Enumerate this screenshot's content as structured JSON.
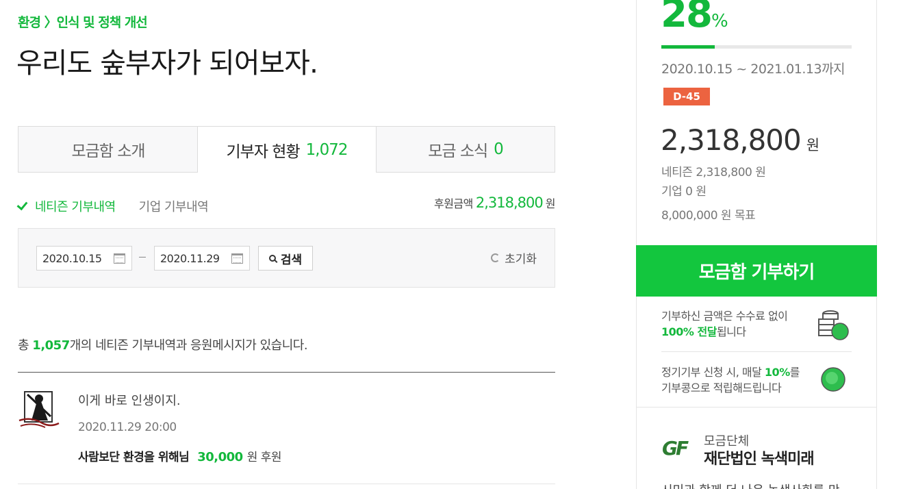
{
  "breadcrumb": "환경 〉인식 및 정책 개선",
  "title": "우리도 숲부자가 되어보자.",
  "tabs": [
    {
      "label": "모금함 소개",
      "count": ""
    },
    {
      "label": "기부자 현황",
      "count": "1,072"
    },
    {
      "label": "모금 소식",
      "count": "0"
    }
  ],
  "filter": {
    "active": "네티즌 기부내역",
    "inactive": "기업 기부내역"
  },
  "total": {
    "label": "후원금액",
    "value": "2,318,800",
    "unit": "원"
  },
  "search": {
    "date_from": "2020.10.15",
    "date_to": "2020.11.29",
    "search_label": "검색",
    "reset_label": "초기화"
  },
  "summary": {
    "prefix": "총 ",
    "count": "1,057",
    "suffix": "개의 네티즌 기부내역과 응원메시지가 있습니다."
  },
  "comment": {
    "message": "이게 바로 인생이지.",
    "date": "2020.11.29 20:00",
    "name": "사람보단 환경을 위해님",
    "amount": "30,000",
    "amount_suffix": "원 후원"
  },
  "campaign": {
    "percent": "28",
    "percent_sign": "%",
    "progress": 0.28,
    "period": "2020.10.15 ~ 2021.01.13까지",
    "dday": "D-45",
    "amount": "2,318,800",
    "amount_unit": "원",
    "netizen": "네티즌 2,318,800 원",
    "company": "기업 0 원",
    "goal": "8,000,000 원 목표",
    "donate_label": "모금함 기부하기",
    "info1_line1": "기부하신 금액은 수수료 없이",
    "info1_highlight": "100% 전달",
    "info1_rest": "됩니다",
    "info2_prefix": "정기기부 신청 시, 매달 ",
    "info2_highlight": "10%",
    "info2_suffix": "를",
    "info2_line2": "기부콩으로 적립해드립니다"
  },
  "org": {
    "logo": "GF",
    "label": "모금단체",
    "name": "재단법인 녹색미래",
    "desc": "시민과 함께 더 나은 녹색사회를 만"
  },
  "colors": {
    "accent": "#13b83c",
    "button": "#13c63e",
    "dday": "#ec6340"
  }
}
